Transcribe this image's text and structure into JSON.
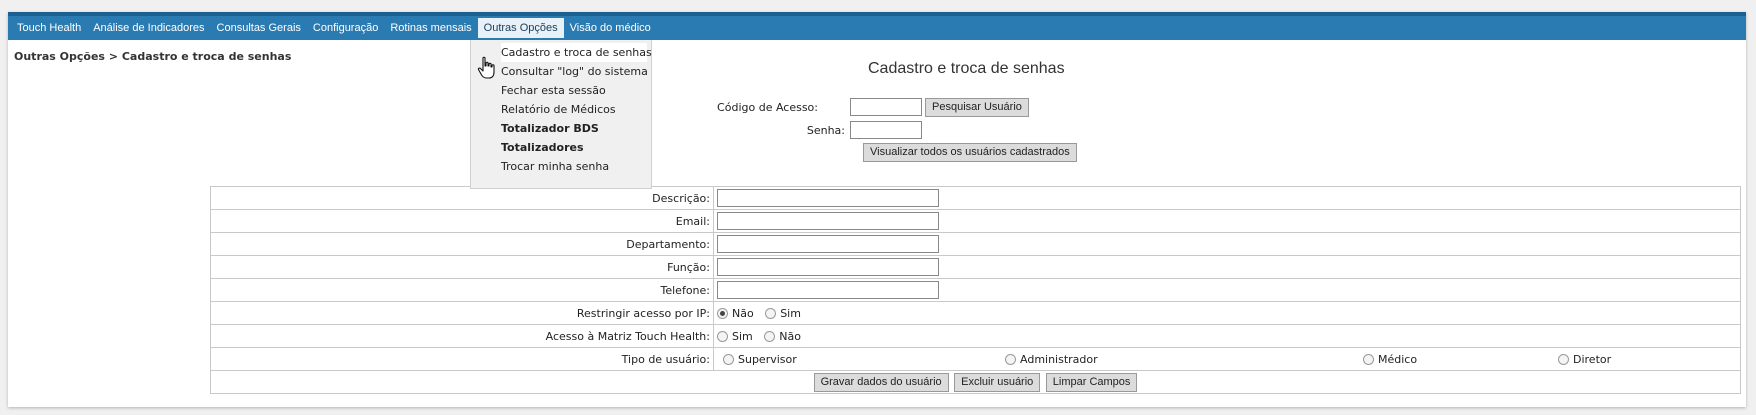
{
  "menu": {
    "items": [
      "Touch Health",
      "Análise de Indicadores",
      "Consultas Gerais",
      "Configuração",
      "Rotinas mensais",
      "Outras Opções",
      "Visão do médico"
    ],
    "active_index": 5
  },
  "breadcrumb": "Outras Opções > Cadastro e troca de senhas",
  "dropdown": {
    "items": [
      "Cadastro e troca de senhas",
      "Consultar \"log\" do sistema",
      "Fechar esta sessão",
      "Relatório de Médicos",
      "Totalizador BDS",
      "Totalizadores",
      "Trocar minha senha"
    ]
  },
  "page_title": "Cadastro e troca de senhas",
  "login": {
    "codigo_label": "Código de Acesso:",
    "codigo_value": "",
    "pesquisar_button": "Pesquisar Usuário",
    "senha_label": "Senha:",
    "senha_value": "",
    "visualizar_button": "Visualizar todos os usuários cadastrados"
  },
  "form": {
    "descricao_label": "Descrição:",
    "email_label": "Email:",
    "departamento_label": "Departamento:",
    "funcao_label": "Função:",
    "telefone_label": "Telefone:",
    "restringir_label": "Restringir acesso por IP:",
    "restringir_options": [
      "Não",
      "Sim"
    ],
    "restringir_selected": "Não",
    "matriz_label": "Acesso à Matriz Touch Health:",
    "matriz_options": [
      "Sim",
      "Não"
    ],
    "tipo_label": "Tipo de usuário:",
    "tipo_options": [
      "Supervisor",
      "Administrador",
      "Médico",
      "Diretor"
    ]
  },
  "actions": {
    "gravar": "Gravar dados do usuário",
    "excluir": "Excluir usuário",
    "limpar": "Limpar Campos"
  },
  "colors": {
    "menubar": "#2b7bb3",
    "menubar_top": "#1c5f90"
  }
}
